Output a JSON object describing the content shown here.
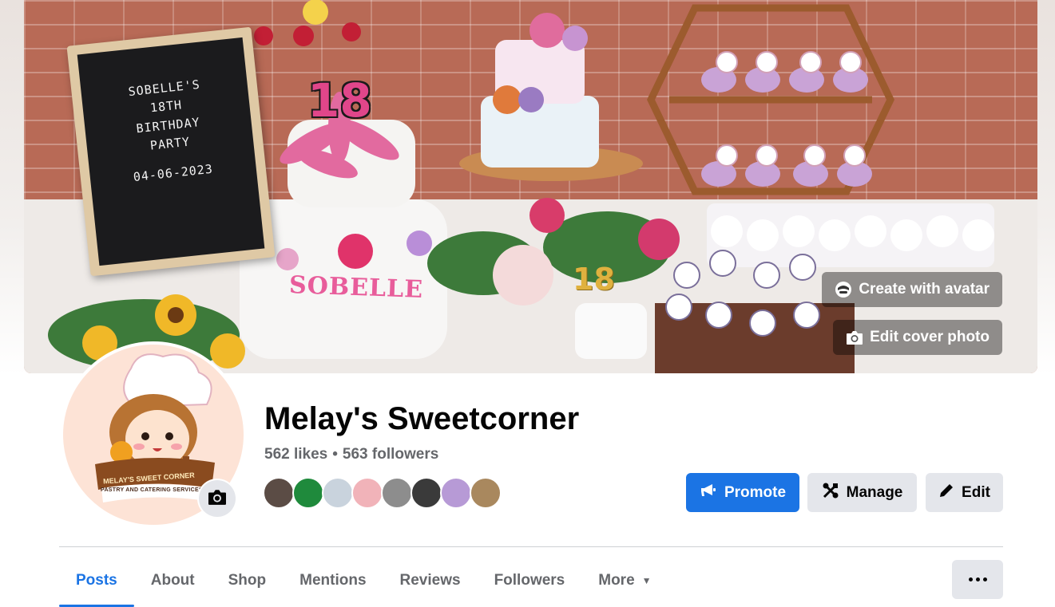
{
  "cover": {
    "letterboard_lines": [
      "SOBELLE'S",
      "18TH",
      "BIRTHDAY",
      "PARTY"
    ],
    "letterboard_date": "04-06-2023",
    "cake_name": "SOBELLE",
    "topper_big": "18",
    "topper_gold": "18",
    "create_avatar_label": "Create with avatar",
    "edit_cover_label": "Edit cover photo"
  },
  "profile": {
    "logo_banner_text": "MELAY'S SWEET CORNER",
    "logo_ribbon_text": "PASTRY AND CATERING SERVICES",
    "name": "Melay's Sweetcorner",
    "likes": "562 likes",
    "separator": "•",
    "followers": "563 followers"
  },
  "follower_faces": [
    "#5b4c45",
    "#1f8a3c",
    "#c9d3dd",
    "#f1b3b9",
    "#8d8d8d",
    "#3a3a3a",
    "#b79ad6",
    "#a9885e"
  ],
  "actions": {
    "promote_label": "Promote",
    "manage_label": "Manage",
    "edit_label": "Edit"
  },
  "tabs": [
    {
      "label": "Posts"
    },
    {
      "label": "About"
    },
    {
      "label": "Shop"
    },
    {
      "label": "Mentions"
    },
    {
      "label": "Reviews"
    },
    {
      "label": "Followers"
    },
    {
      "label": "More"
    }
  ],
  "colors": {
    "accent": "#1b74e4",
    "secondary_button": "#e4e6eb",
    "muted_text": "#65676b"
  }
}
